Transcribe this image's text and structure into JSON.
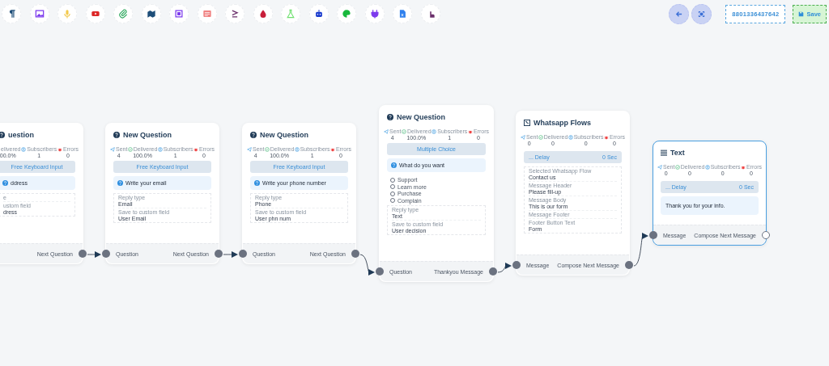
{
  "toolbar": {
    "phone": "8801336437642",
    "save": "Save"
  },
  "nodes": [
    {
      "kind": "question",
      "title": "uestion",
      "selected": false,
      "stats": [
        {
          "kind": "delivered",
          "label": "elivered",
          "value": "00.0%"
        },
        {
          "kind": "subscribers",
          "label": "Subscribers",
          "value": "1"
        },
        {
          "kind": "errors",
          "label": "Errors",
          "value": "0"
        }
      ],
      "type_button": "Free Keyboard Input",
      "prompt": "ddress",
      "fields": [
        {
          "label": "e"
        },
        {
          "label": "ustom field",
          "value": "dress"
        }
      ],
      "ports": {
        "out": "Next Question",
        "connected": true
      }
    },
    {
      "kind": "question",
      "title": "New Question",
      "selected": false,
      "stats": [
        {
          "kind": "sent",
          "label": "Sent",
          "value": "4"
        },
        {
          "kind": "delivered",
          "label": "Delivered",
          "value": "100.0%"
        },
        {
          "kind": "subscribers",
          "label": "Subscribers",
          "value": "1"
        },
        {
          "kind": "errors",
          "label": "Errors",
          "value": "0"
        }
      ],
      "type_button": "Free Keyboard Input",
      "prompt": "Write your email",
      "fields": [
        {
          "label": "Reply type",
          "value": "Email"
        },
        {
          "label": "Save to custom field",
          "value": "User Email"
        }
      ],
      "ports": {
        "in": "Question",
        "out": "Next Question",
        "connected": true
      }
    },
    {
      "kind": "question",
      "title": "New Question",
      "selected": false,
      "stats": [
        {
          "kind": "sent",
          "label": "Sent",
          "value": "4"
        },
        {
          "kind": "delivered",
          "label": "Delivered",
          "value": "100.0%"
        },
        {
          "kind": "subscribers",
          "label": "Subscribers",
          "value": "1"
        },
        {
          "kind": "errors",
          "label": "Errors",
          "value": "0"
        }
      ],
      "type_button": "Free Keyboard Input",
      "prompt": "Write your phone number",
      "fields": [
        {
          "label": "Reply type",
          "value": "Phone"
        },
        {
          "label": "Save to custom field",
          "value": "User phn num"
        }
      ],
      "ports": {
        "in": "Question",
        "out": "Next Question",
        "connected": true
      }
    },
    {
      "kind": "question",
      "title": "New Question",
      "selected": false,
      "stats": [
        {
          "kind": "sent",
          "label": "Sent",
          "value": "4"
        },
        {
          "kind": "delivered",
          "label": "Delivered",
          "value": "100.0%"
        },
        {
          "kind": "subscribers",
          "label": "Subscribers",
          "value": "1"
        },
        {
          "kind": "errors",
          "label": "Errors",
          "value": "0"
        }
      ],
      "type_button": "Multiple Choice",
      "prompt": "What do you want",
      "options": [
        {
          "label": "Support",
          "selected": false
        },
        {
          "label": "Learn more",
          "selected": false
        },
        {
          "label": "Purchase",
          "selected": false
        },
        {
          "label": "Complain",
          "selected": false
        }
      ],
      "fields": [
        {
          "label": "Reply type",
          "value": "Text"
        },
        {
          "label": "Save to custom field",
          "value": "User decision"
        }
      ],
      "ports": {
        "in": "Question",
        "out": "Thankyou Message",
        "connected": true
      }
    },
    {
      "kind": "whatsapp_flow",
      "title": "Whatsapp Flows",
      "selected": false,
      "stats": [
        {
          "kind": "sent",
          "label": "Sent",
          "value": "0"
        },
        {
          "kind": "delivered",
          "label": "Delivered",
          "value": "0"
        },
        {
          "kind": "subscribers",
          "label": "Subscribers",
          "value": "0"
        },
        {
          "kind": "errors",
          "label": "Errors",
          "value": "0"
        }
      ],
      "delay": {
        "label": "... Delay",
        "value": "0 Sec"
      },
      "fields": [
        {
          "label": "Selected Whatsapp Flow",
          "value": "Contact us"
        },
        {
          "label": "Message Header",
          "value": "Please fill-up"
        },
        {
          "label": "Message Body",
          "value": "This is our form"
        },
        {
          "label": "Message Footer"
        },
        {
          "label": "Footer Button Text",
          "value": "Form"
        }
      ],
      "ports": {
        "in": "Message",
        "out": "Compose Next Message",
        "connected": true
      }
    },
    {
      "kind": "text",
      "title": "Text",
      "selected": true,
      "stats": [
        {
          "kind": "sent",
          "label": "Sent",
          "value": "0"
        },
        {
          "kind": "delivered",
          "label": "Delivered",
          "value": "0"
        },
        {
          "kind": "subscribers",
          "label": "Subscribers",
          "value": "0"
        },
        {
          "kind": "errors",
          "label": "Errors",
          "value": "0"
        }
      ],
      "delay": {
        "label": "... Delay",
        "value": "0 Sec"
      },
      "message": "Thank you for your info.",
      "ports": {
        "in": "Message",
        "out": "Compose Next Message",
        "connected": false
      }
    }
  ]
}
